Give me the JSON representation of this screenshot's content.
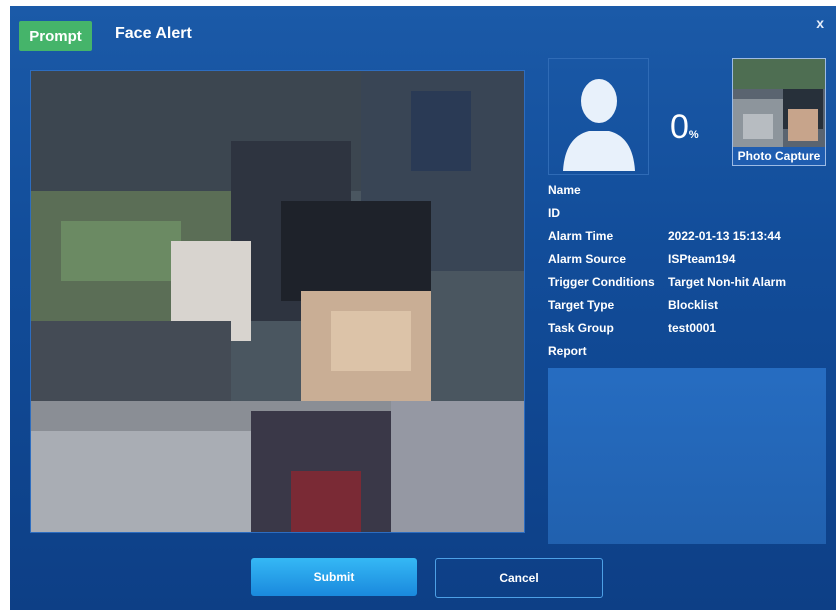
{
  "header": {
    "tag": "Prompt",
    "title": "Face Alert",
    "close": "x"
  },
  "match": {
    "percent": "0",
    "percent_unit": "%",
    "capture_label": "Photo Capture"
  },
  "info": {
    "rows": [
      {
        "label": "Name",
        "value": ""
      },
      {
        "label": "ID",
        "value": ""
      },
      {
        "label": "Alarm Time",
        "value": "2022-01-13 15:13:44"
      },
      {
        "label": "Alarm Source",
        "value": "ISPteam194"
      },
      {
        "label": "Trigger Conditions",
        "value": "Target Non-hit Alarm"
      },
      {
        "label": "Target Type",
        "value": "Blocklist"
      },
      {
        "label": "Task Group",
        "value": "test0001"
      },
      {
        "label": "Report",
        "value": ""
      }
    ]
  },
  "buttons": {
    "submit": "Submit",
    "cancel": "Cancel"
  },
  "colors": {
    "tag": "#45b46a",
    "dialog": "#1b5aa8",
    "submit": "#1a89dd",
    "avatar": "#e6f0fb"
  }
}
